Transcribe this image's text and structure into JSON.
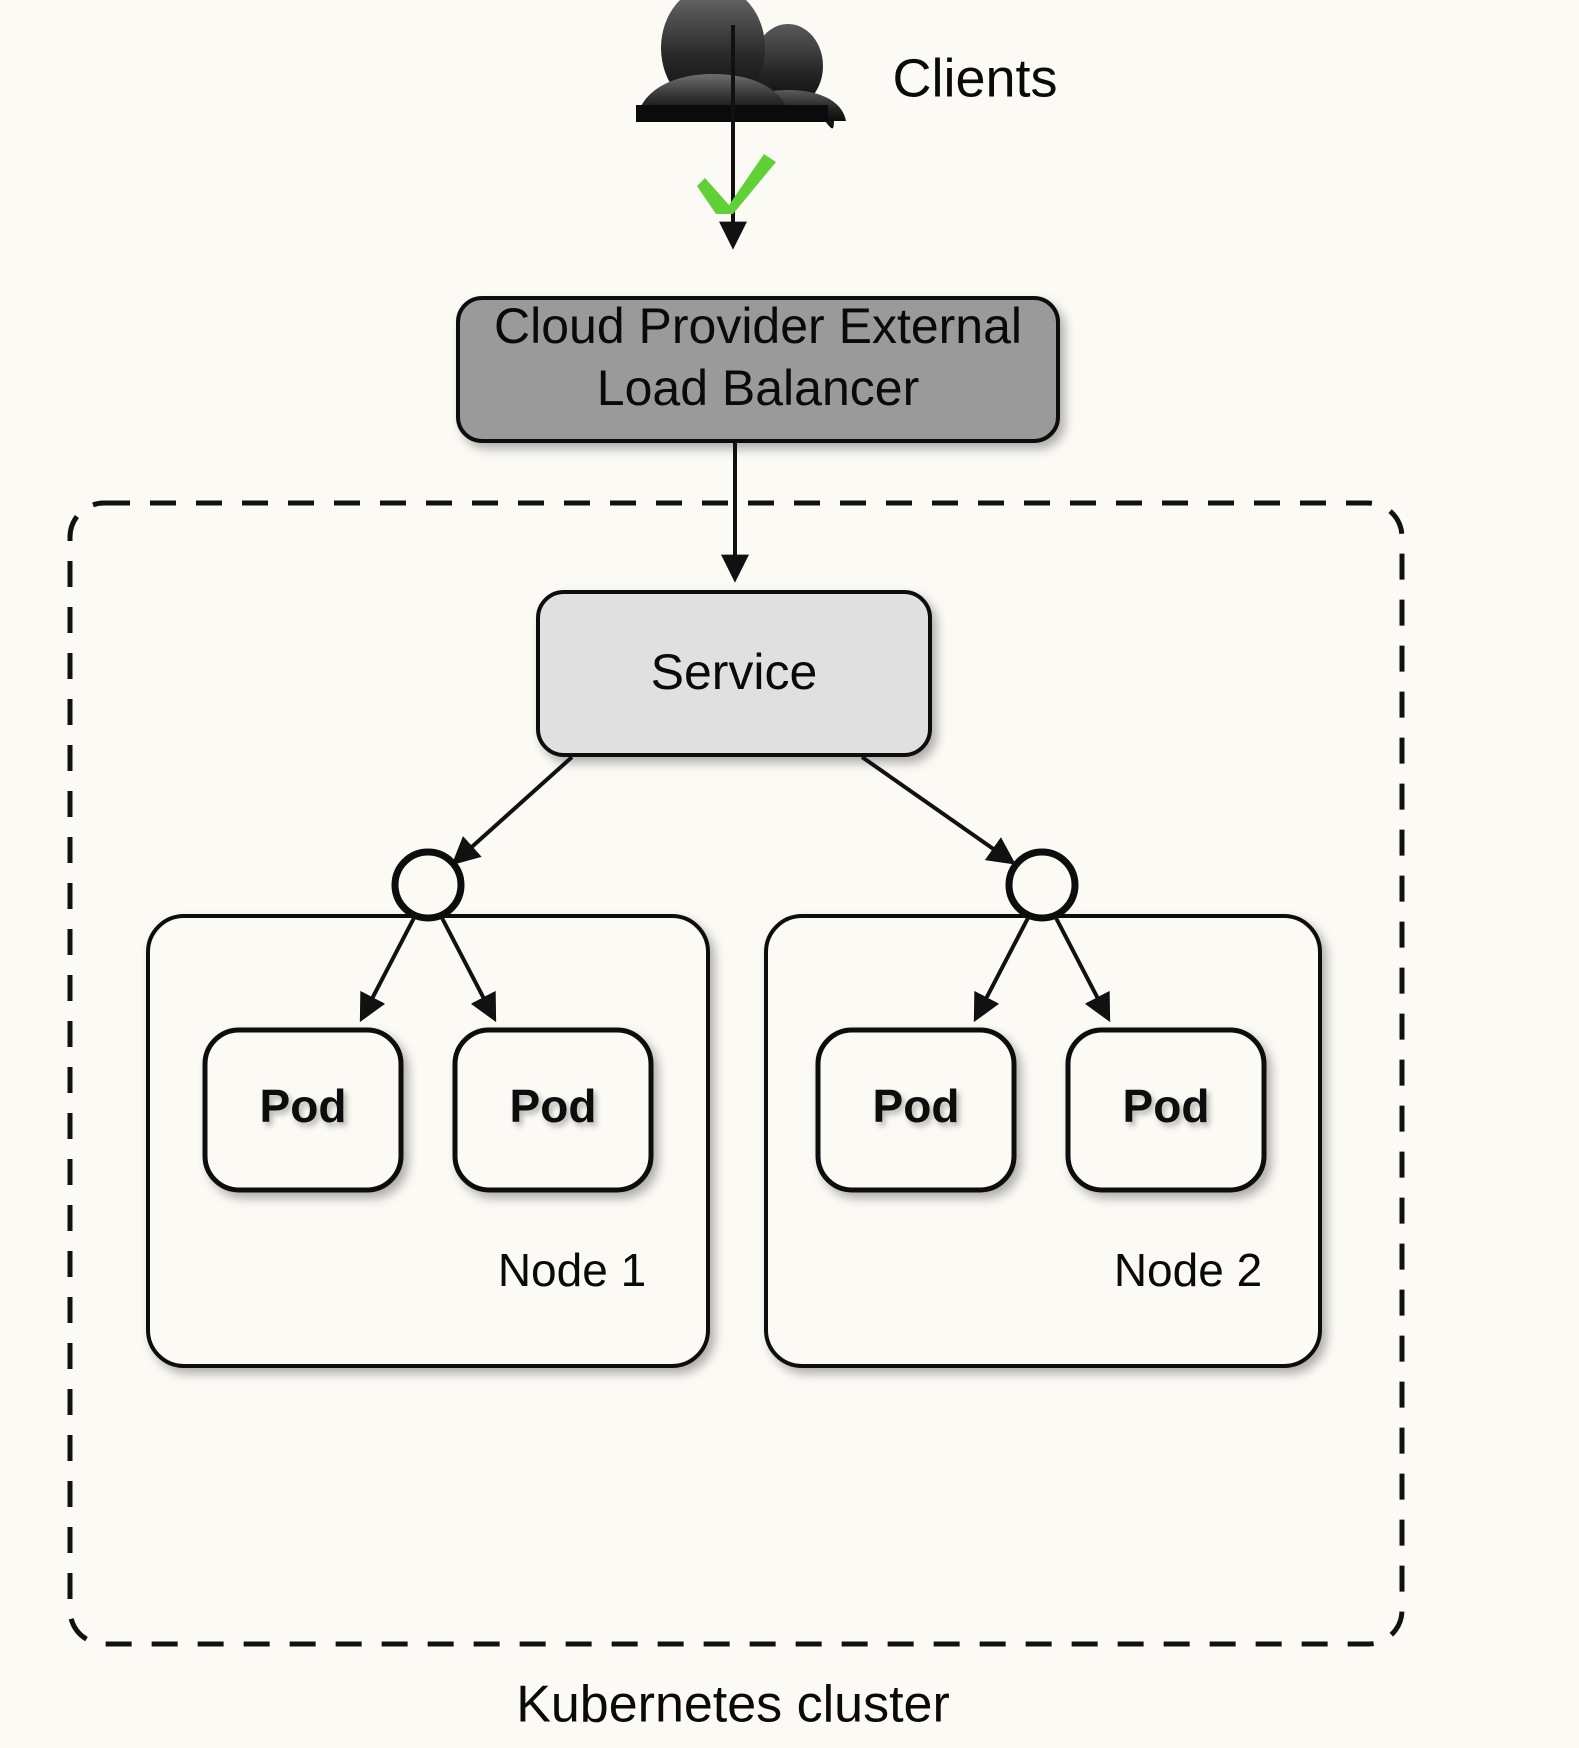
{
  "diagram": {
    "title_bottom": "Kubernetes cluster",
    "background_color": "#fbfaf5",
    "clients": {
      "label": "Clients",
      "icon": "people-icon"
    },
    "check_mark": {
      "symbol": "✔",
      "color": "#5fd035"
    },
    "load_balancer": {
      "line1": "Cloud Provider External",
      "line2": "Load Balancer",
      "fill": "#9a9a9a",
      "stroke": "#0d0d0d"
    },
    "service": {
      "label": "Service",
      "fill": "#e0e0e0",
      "stroke": "#0d0d0d"
    },
    "endpoints": [
      {
        "name": "endpoint-circle-node-1"
      },
      {
        "name": "endpoint-circle-node-2"
      }
    ],
    "nodes": [
      {
        "label": "Node 1",
        "pods": [
          {
            "label": "Pod"
          },
          {
            "label": "Pod"
          }
        ]
      },
      {
        "label": "Node 2",
        "pods": [
          {
            "label": "Pod"
          },
          {
            "label": "Pod"
          }
        ]
      }
    ]
  }
}
